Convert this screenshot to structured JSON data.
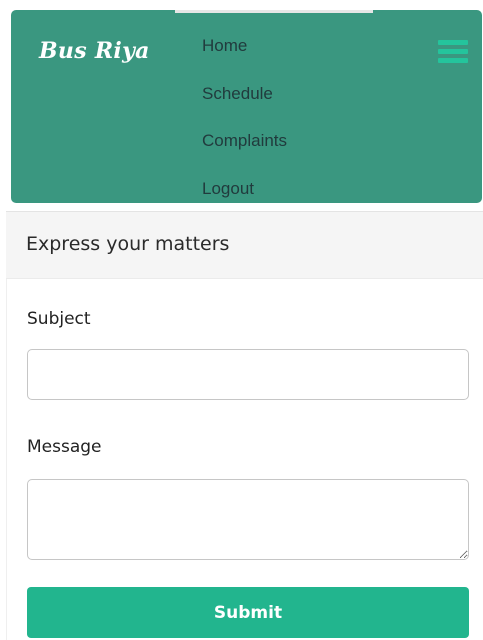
{
  "navbar": {
    "brand": "Bus Riya",
    "items": [
      {
        "label": "Home"
      },
      {
        "label": "Schedule"
      },
      {
        "label": "Complaints"
      },
      {
        "label": "Logout"
      }
    ],
    "toggle_icon": "hamburger-menu-icon",
    "background_color": "#3a9780",
    "toggle_color": "#24c49c"
  },
  "form": {
    "title": "Express your matters",
    "subject_label": "Subject",
    "subject_value": "",
    "message_label": "Message",
    "message_value": "",
    "submit_label": "Submit",
    "submit_color": "#22b58e"
  }
}
